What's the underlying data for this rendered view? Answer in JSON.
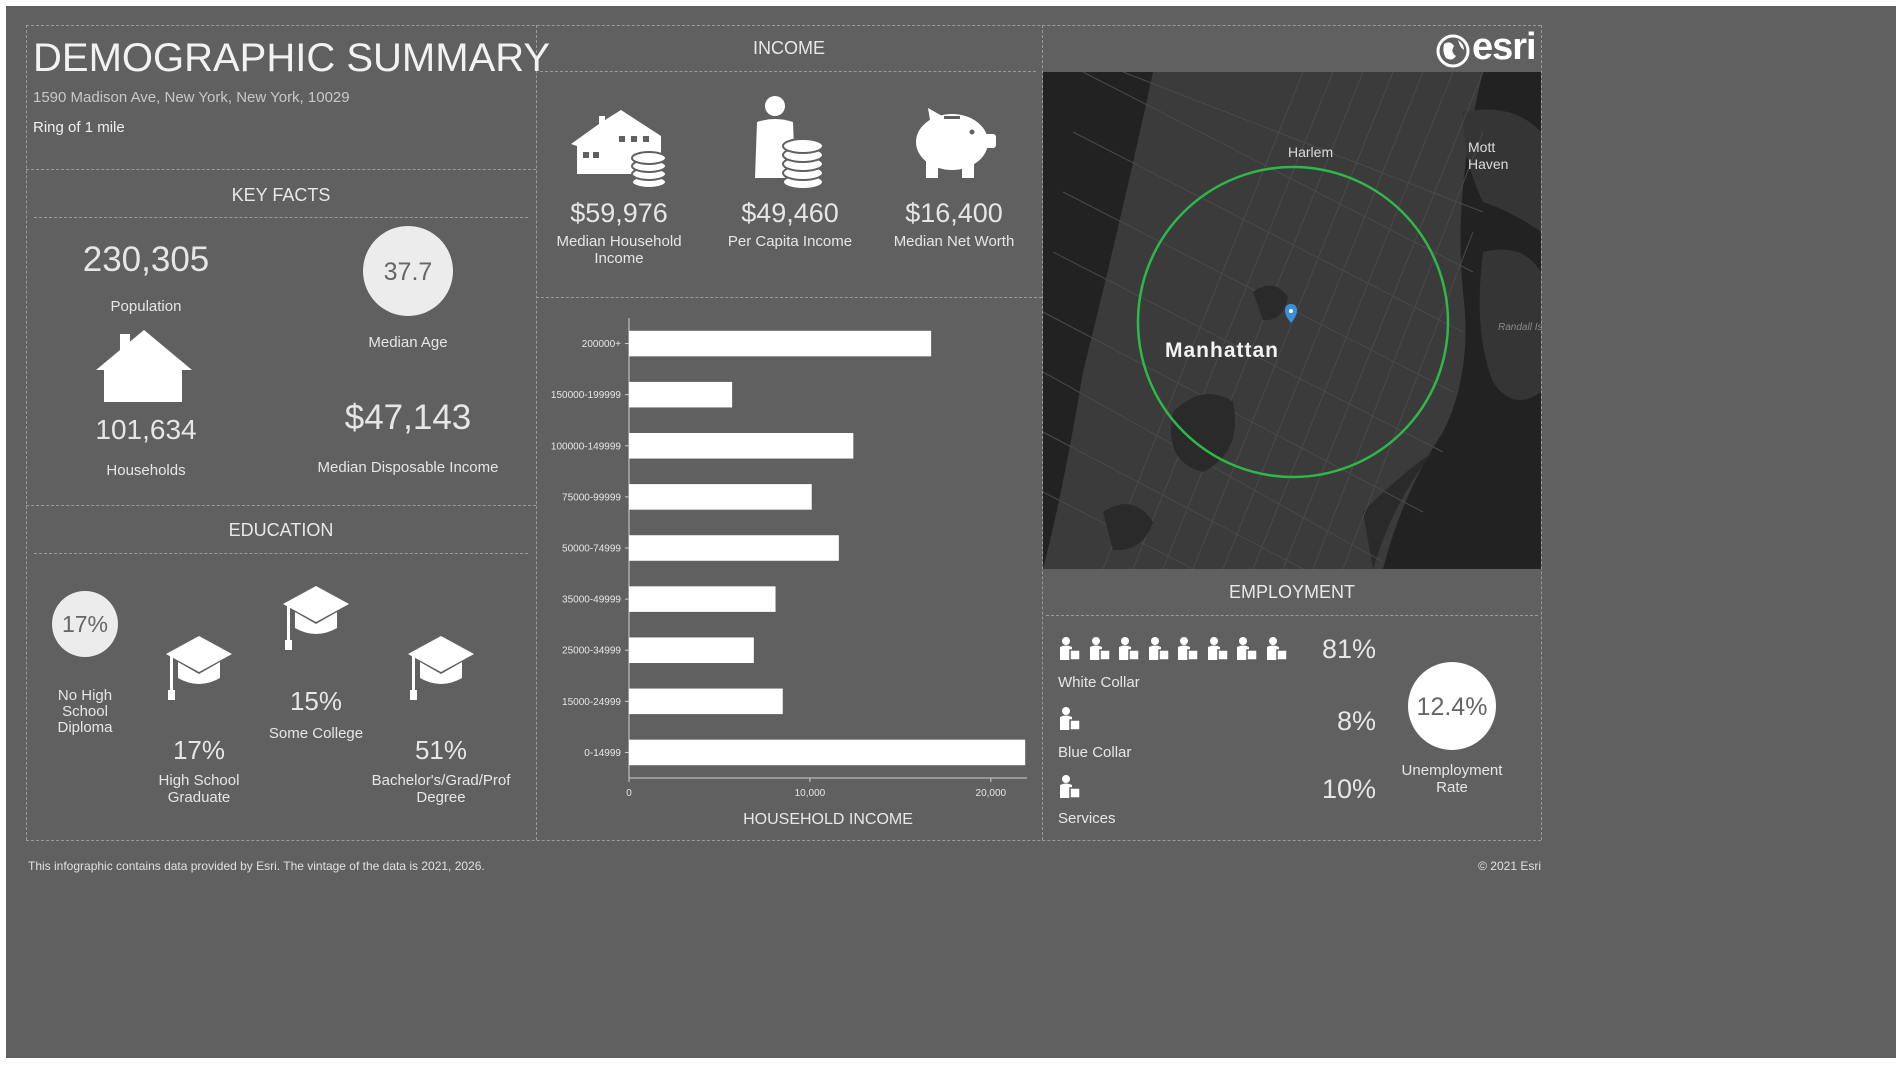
{
  "header": {
    "title": "DEMOGRAPHIC SUMMARY",
    "address": "1590 Madison Ave, New York, New York, 10029",
    "ring": "Ring of 1 mile"
  },
  "key_facts": {
    "title": "KEY FACTS",
    "population_value": "230,305",
    "population_label": "Population",
    "median_age_value": "37.7",
    "median_age_label": "Median Age",
    "households_value": "101,634",
    "households_label": "Households",
    "disposable_income_value": "$47,143",
    "disposable_income_label": "Median Disposable Income"
  },
  "education": {
    "title": "EDUCATION",
    "no_hs_value": "17%",
    "no_hs_label": "No High School Diploma",
    "hs_value": "17%",
    "hs_label": "High School Graduate",
    "some_college_value": "15%",
    "some_college_label": "Some College",
    "bachelors_value": "51%",
    "bachelors_label": "Bachelor's/Grad/Prof Degree"
  },
  "income": {
    "title": "INCOME",
    "median_hh_value": "$59,976",
    "median_hh_label": "Median Household Income",
    "per_capita_value": "$49,460",
    "per_capita_label": "Per Capita Income",
    "net_worth_value": "$16,400",
    "net_worth_label": "Median Net Worth"
  },
  "chart_data": {
    "type": "bar",
    "orientation": "horizontal",
    "categories": [
      "200000+",
      "150000-199999",
      "100000-149999",
      "75000-99999",
      "50000-74999",
      "35000-49999",
      "25000-34999",
      "15000-24999",
      "0-14999"
    ],
    "values": [
      16700,
      5700,
      12400,
      10100,
      11600,
      8100,
      6900,
      8500,
      21900
    ],
    "xlabel": "HOUSEHOLD INCOME",
    "xlim": [
      0,
      22000
    ],
    "xticks": [
      0,
      10000,
      20000
    ],
    "xtick_labels": [
      "0",
      "10,000",
      "20,000"
    ],
    "grid": false,
    "bar_color": "#ffffff"
  },
  "map": {
    "labels": {
      "harlem": "Harlem",
      "mott_haven": "Mott Haven",
      "manhattan": "Manhattan",
      "randalls": "Randall Isl"
    },
    "ring_color": "#2fb84a",
    "pin_color": "#3a8fd8"
  },
  "brand": {
    "logo_text": "esri"
  },
  "employment": {
    "title": "EMPLOYMENT",
    "white_collar_value": "81%",
    "white_collar_label": "White Collar",
    "blue_collar_value": "8%",
    "blue_collar_label": "Blue Collar",
    "services_value": "10%",
    "services_label": "Services",
    "unemployment_value": "12.4%",
    "unemployment_label": "Unemployment Rate"
  },
  "footer": {
    "note": "This infographic contains data provided by Esri. The vintage of the data is 2021, 2026.",
    "copyright": "© 2021 Esri"
  },
  "icons": [
    "house-with-coins-icon",
    "person-with-coins-icon",
    "piggy-bank-icon",
    "house-icon",
    "graduation-cap-icon",
    "worker-icon",
    "globe-icon",
    "map-pin-icon"
  ]
}
